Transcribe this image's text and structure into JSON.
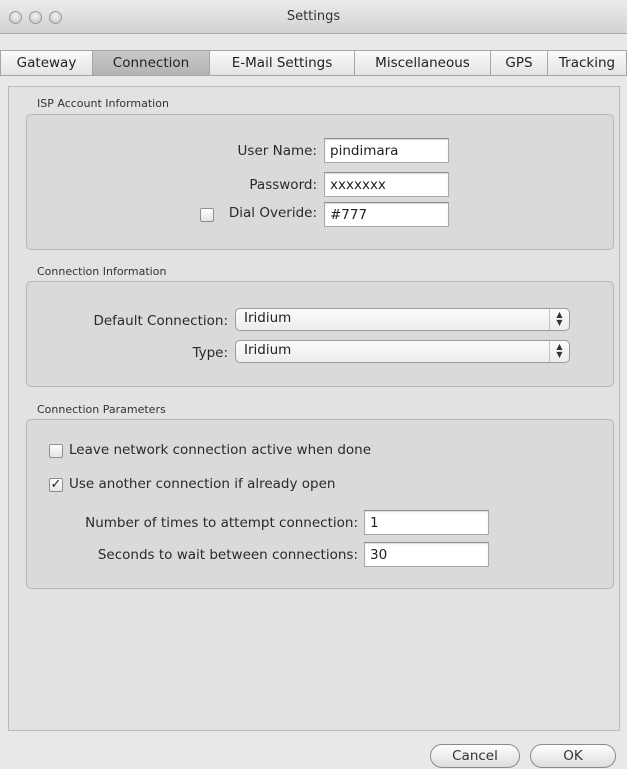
{
  "window": {
    "title": "Settings",
    "buttons": [
      "close-icon",
      "minimize-icon",
      "zoom-icon"
    ]
  },
  "tabs": [
    {
      "label": "Gateway",
      "active": false
    },
    {
      "label": "Connection",
      "active": true
    },
    {
      "label": "E-Mail Settings",
      "active": false
    },
    {
      "label": "Miscellaneous",
      "active": false
    },
    {
      "label": "GPS",
      "active": false
    },
    {
      "label": "Tracking",
      "active": false
    }
  ],
  "isp": {
    "group_label": "ISP Account Information",
    "user_name_label": "User Name:",
    "user_name_value": "pindimara",
    "password_label": "Password:",
    "password_value": "xxxxxxx",
    "dial_override_label": "Dial Overide:",
    "dial_override_checked": false,
    "dial_override_value": "#777"
  },
  "connection_info": {
    "group_label": "Connection Information",
    "default_connection_label": "Default Connection:",
    "default_connection_value": "Iridium",
    "type_label": "Type:",
    "type_value": "Iridium",
    "popup_arrow_icon": "up-down-arrows-icon"
  },
  "connection_params": {
    "group_label": "Connection Parameters",
    "leave_active_label": "Leave network connection active when done",
    "leave_active_checked": false,
    "use_another_label": "Use another connection if already open",
    "use_another_checked": true,
    "attempts_label": "Number of times to attempt connection:",
    "attempts_value": "1",
    "wait_label": "Seconds to wait between connections:",
    "wait_value": "30"
  },
  "footer": {
    "cancel_label": "Cancel",
    "ok_label": "OK"
  }
}
